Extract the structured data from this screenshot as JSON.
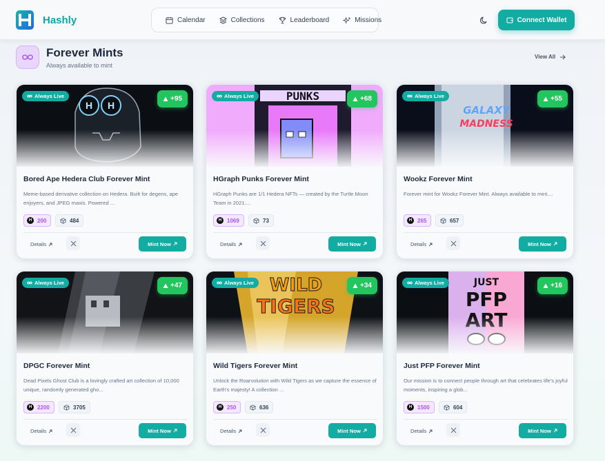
{
  "app": {
    "brand": "Hashly",
    "nav": [
      {
        "label": "Calendar",
        "icon": "calendar-icon"
      },
      {
        "label": "Collections",
        "icon": "layers-icon"
      },
      {
        "label": "Leaderboard",
        "icon": "trophy-icon"
      },
      {
        "label": "Missions",
        "icon": "sparkles-icon"
      }
    ],
    "connect_label": "Connect Wallet",
    "accent": "#13aca3"
  },
  "section": {
    "title": "Forever Mints",
    "subtitle": "Always available to mint",
    "view_all": "View All"
  },
  "labels": {
    "live_badge": "Always Live",
    "details": "Details",
    "mint": "Mint Now",
    "hbar_symbol": "H"
  },
  "cards": [
    {
      "title": "Bored Ape Hedera Club Forever Mint",
      "desc": "Meme-based derivative collection on Hedera. Built for degens, ape enjoyers, and JPEG maxis. Powered ...",
      "price": "200",
      "supply": "484",
      "score": "+95",
      "art": "skull"
    },
    {
      "title": "HGraph Punks Forever Mint",
      "desc": "HGraph Punks are 1/1 Hedera NFTs — created by the Turtle Moon Team in 2021....",
      "price": "1069",
      "supply": "73",
      "score": "+68",
      "art": "punks"
    },
    {
      "title": "Wookz Forever Mint",
      "desc": "Forever mint for Wookz Forever Mint. Always available to mint....",
      "price": "265",
      "supply": "657",
      "score": "+55",
      "art": "galaxy"
    },
    {
      "title": "DPGC Forever Mint",
      "desc": "Dead Pixels Ghost Club is a lovingly crafted art collection of 10,000 unique, randomly generated gho...",
      "price": "2200",
      "supply": "3705",
      "score": "+47",
      "art": "dpgc"
    },
    {
      "title": "Wild Tigers Forever Mint",
      "desc": "Unlock the Roarvolution with Wild Tigers as we capture the essence of Earth's majesty! A collection ...",
      "price": "250",
      "supply": "636",
      "score": "+34",
      "art": "tigers"
    },
    {
      "title": "Just PFP Forever Mint",
      "desc": "Our mission is to connect people through art that celebrates life's joyful moments, inspiring a glob...",
      "price": "1500",
      "supply": "604",
      "score": "+16",
      "art": "pfp"
    }
  ],
  "art_text": {
    "punks": "PUNKS",
    "galaxy_1": "GALAXY",
    "galaxy_2": "MADNESS",
    "tigers_1": "WILD",
    "tigers_2": "TIGERS",
    "pfp_1": "JUST",
    "pfp_2": "PFP",
    "pfp_3": "ART"
  }
}
